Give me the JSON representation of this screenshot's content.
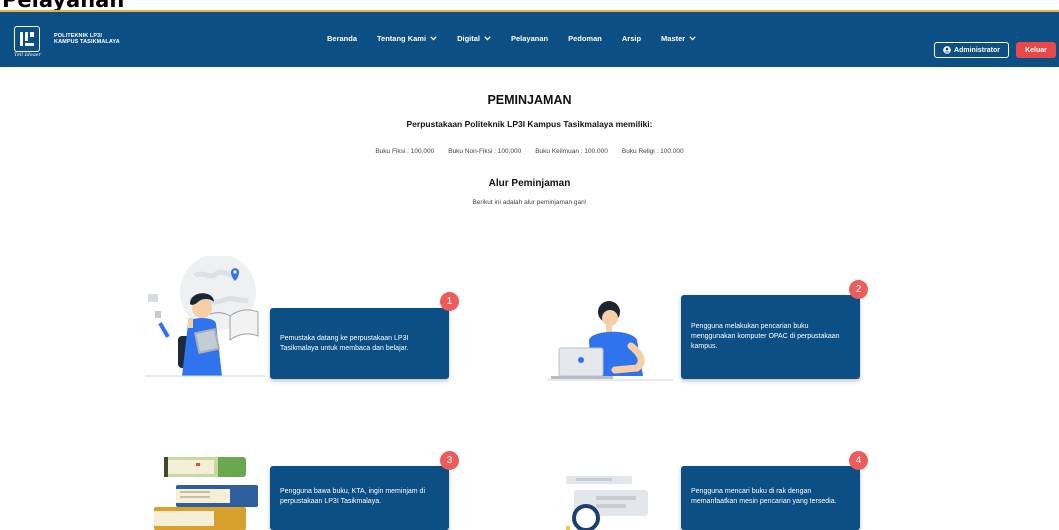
{
  "page_heading": "Pelayanan",
  "brand": {
    "line1": "POLITEKNIK LP3I",
    "line2": "KAMPUS TASIKMALAYA",
    "logo_mark": "LP3I",
    "signature": "Tell Ideaer"
  },
  "nav": {
    "items": [
      {
        "label": "Beranda",
        "dropdown": false
      },
      {
        "label": "Tentang Kami",
        "dropdown": true
      },
      {
        "label": "Digital",
        "dropdown": true
      },
      {
        "label": "Pelayanan",
        "dropdown": false
      },
      {
        "label": "Pedoman",
        "dropdown": false
      },
      {
        "label": "Arsip",
        "dropdown": false
      },
      {
        "label": "Master",
        "dropdown": true
      }
    ],
    "admin_label": "Administrator",
    "logout_label": "Keluar"
  },
  "content": {
    "title": "PEMINJAMAN",
    "subtitle": "Perpustakaan Politeknik LP3I Kampus Tasikmalaya memiliki:",
    "stats": [
      "Buku Fiksi : 100.000",
      "Buku Non-Fiksi : 100.000",
      "Buku Keilmuan : 100.000",
      "Buku Religi : 100.000"
    ],
    "flow_title": "Alur Peminjaman",
    "flow_desc": "Berikut ini adalah alur peminjaman gan!"
  },
  "steps": [
    {
      "number": "1",
      "text": "Pemustaka datang ke perpustakaan LP3I Tasikmalaya untuk membaca dan belajar.",
      "icon": "student-with-books-illustration"
    },
    {
      "number": "2",
      "text": "Pengguna melakukan pencarian buku menggunakan komputer OPAC di perpustakaan kampus.",
      "icon": "person-at-laptop-illustration"
    },
    {
      "number": "3",
      "text": "Pengguna bawa buku, KTA, ingin meminjam di perpustakaan LP3I Tasikmalaya.",
      "icon": "stack-of-books-illustration"
    },
    {
      "number": "4",
      "text": "Pengguna mencari buku di rak dengan memanfaatkan mesin pencarian yang tersedia.",
      "icon": "search-illustration"
    }
  ],
  "colors": {
    "navbar": "#0c4f84",
    "card": "#0c4f84",
    "badge": "#ee5b5b",
    "logout": "#e94848",
    "heading_rule": "#e7b53a"
  }
}
